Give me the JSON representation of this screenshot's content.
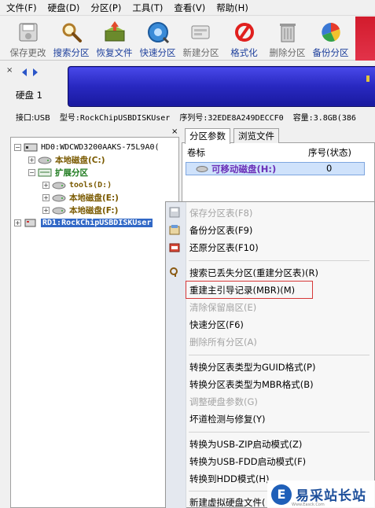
{
  "menubar": [
    "文件(F)",
    "硬盘(D)",
    "分区(P)",
    "工具(T)",
    "查看(V)",
    "帮助(H)"
  ],
  "toolbar": [
    {
      "label": "保存更改",
      "icon": "save-disk-icon",
      "style": "gray"
    },
    {
      "label": "搜索分区",
      "icon": "magnifier-icon",
      "style": "blue"
    },
    {
      "label": "恢复文件",
      "icon": "recover-box-icon",
      "style": "blue"
    },
    {
      "label": "快速分区",
      "icon": "quick-partition-icon",
      "style": "blue"
    },
    {
      "label": "新建分区",
      "icon": "new-partition-icon",
      "style": "gray"
    },
    {
      "label": "格式化",
      "icon": "format-icon",
      "style": "blue"
    },
    {
      "label": "删除分区",
      "icon": "trash-icon",
      "style": "gray"
    },
    {
      "label": "备份分区",
      "icon": "backup-icon",
      "style": "blue"
    }
  ],
  "diskband": {
    "disk_label": "硬盘 1",
    "info": {
      "interface": "接口:USB",
      "model": "型号:RockChipUSBDISKUser",
      "serial": "序列号:32EDE8A249DECCF0",
      "capacity": "容量:3.8GB(386"
    }
  },
  "tree": {
    "hd0": "HD0:WDCWD3200AAKS-75L9A0(",
    "c_drive": "本地磁盘(C:)",
    "extended": "扩展分区",
    "tools": "tools(D:)",
    "e_drive": "本地磁盘(E:)",
    "f_drive": "本地磁盘(F:)",
    "rd1": "RD1:RockChipUSBDISKUser"
  },
  "tabs": [
    "分区参数",
    "浏览文件"
  ],
  "table": {
    "columns": [
      "卷标",
      "序号(状态)"
    ],
    "rows": [
      {
        "label": "可移动磁盘(H:)",
        "index": "0"
      }
    ]
  },
  "context_menu": [
    {
      "label": "保存分区表(F8)",
      "disabled": true,
      "icon": "save-table-icon"
    },
    {
      "label": "备份分区表(F9)",
      "disabled": false,
      "icon": "backup-table-icon"
    },
    {
      "label": "还原分区表(F10)",
      "disabled": false,
      "icon": "restore-table-icon"
    },
    {
      "label": "搜索已丢失分区(重建分区表)(R)",
      "disabled": false,
      "icon": "search-lost-icon"
    },
    {
      "label": "重建主引导记录(MBR)(M)",
      "disabled": false
    },
    {
      "label": "清除保留扇区(E)",
      "disabled": true
    },
    {
      "label": "快速分区(F6)",
      "disabled": false
    },
    {
      "label": "删除所有分区(A)",
      "disabled": true
    },
    {
      "label": "转换分区表类型为GUID格式(P)",
      "disabled": false
    },
    {
      "label": "转换分区表类型为MBR格式(B)",
      "disabled": false
    },
    {
      "label": "调整硬盘参数(G)",
      "disabled": true
    },
    {
      "label": "坏道检测与修复(Y)",
      "disabled": false
    },
    {
      "label": "转换为USB-ZIP启动模式(Z)",
      "disabled": false
    },
    {
      "label": "转换为USB-FDD启动模式(F)",
      "disabled": false
    },
    {
      "label": "转换到HDD模式(H)",
      "disabled": false
    },
    {
      "label": "新建虚拟硬盘文件(",
      "disabled": false
    }
  ],
  "watermark": {
    "logo": "E",
    "text": "易采站长站",
    "sub": "Www.Easck.Com"
  },
  "colors": {
    "accent_blue": "#1d3f9c",
    "disk_bar": "#2222b8",
    "highlight_box": "#d63838",
    "selection": "#3168c6"
  }
}
